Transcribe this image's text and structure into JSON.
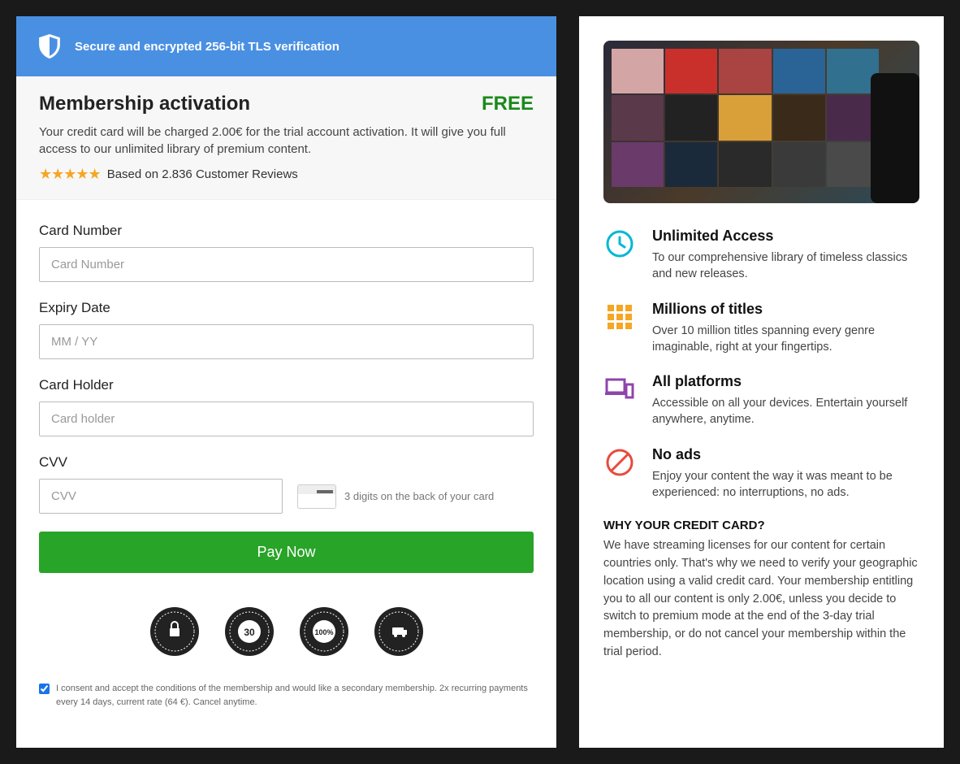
{
  "secure_banner": "Secure and encrypted 256-bit TLS verification",
  "activation": {
    "title": "Membership activation",
    "free_label": "FREE",
    "charge_text": "Your credit card will be charged 2.00€ for the trial account activation. It will give you full access to our unlimited library of premium content.",
    "reviews_text": "Based on 2.836 Customer Reviews"
  },
  "form": {
    "card_number": {
      "label": "Card Number",
      "placeholder": "Card Number",
      "value": ""
    },
    "expiry": {
      "label": "Expiry Date",
      "placeholder": "MM / YY",
      "value": ""
    },
    "holder": {
      "label": "Card Holder",
      "placeholder": "Card holder",
      "value": ""
    },
    "cvv": {
      "label": "CVV",
      "placeholder": "CVV",
      "value": "",
      "hint": "3 digits on the back of your card"
    },
    "pay_button": "Pay Now"
  },
  "badges": {
    "b1": "SECURE ORDERING",
    "b2": "MONEY BACK 30 DAYS GUARANTEE",
    "b3": "SATISFACTION 100% GUARANTEED",
    "b4": "EASY RETURNS"
  },
  "consent": {
    "checked": true,
    "text": "I consent and accept the conditions of the membership and would like a secondary membership. 2x recurring payments every 14 days, current rate (64 €). Cancel anytime."
  },
  "features": [
    {
      "icon": "clock",
      "title": "Unlimited Access",
      "desc": "To our comprehensive library of timeless classics and new releases."
    },
    {
      "icon": "grid",
      "title": "Millions of titles",
      "desc": "Over 10 million titles spanning every genre imaginable, right at your fingertips."
    },
    {
      "icon": "devices",
      "title": "All platforms",
      "desc": "Accessible on all your devices. Entertain yourself anywhere, anytime."
    },
    {
      "icon": "noads",
      "title": "No ads",
      "desc": "Enjoy your content the way it was meant to be experienced: no interruptions, no ads."
    }
  ],
  "why": {
    "title": "WHY YOUR CREDIT CARD?",
    "text": "We have streaming licenses for our content for certain countries only. That's why we need to verify your geographic location using a valid credit card. Your membership entitling you to all our content is only 2.00€, unless you decide to switch to premium mode at the end of the 3-day trial membership, or do not cancel your membership within the trial period."
  }
}
